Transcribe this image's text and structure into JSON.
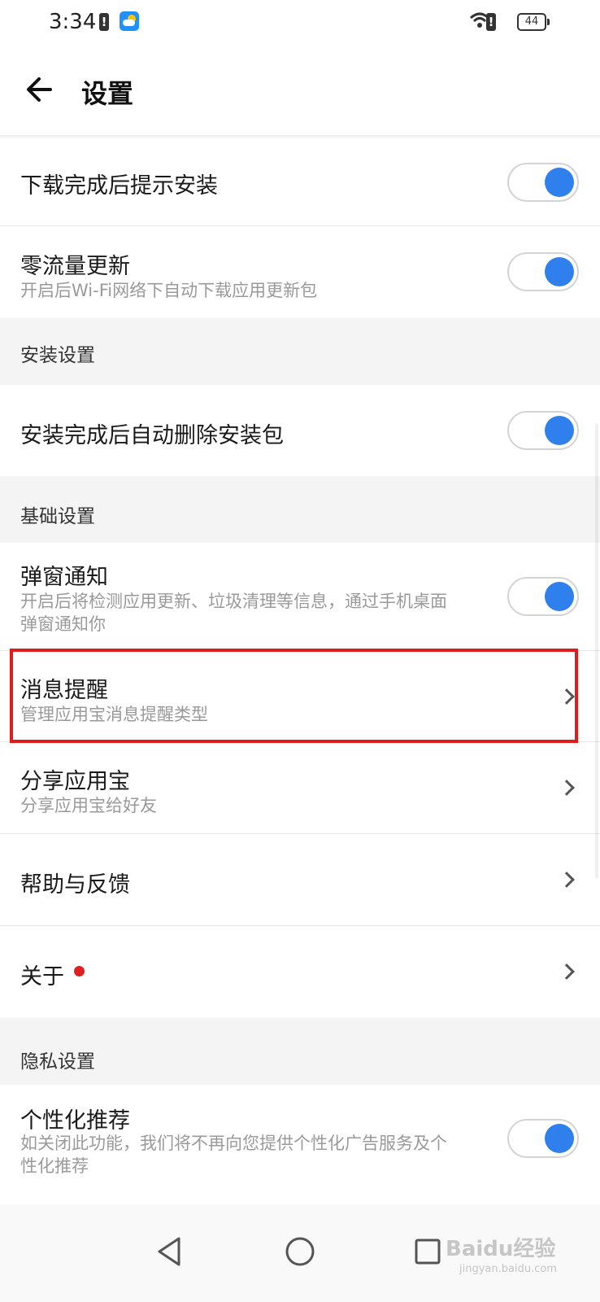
{
  "status_bar": {
    "time": "3:34",
    "battery_level": "44"
  },
  "header": {
    "title": "设置"
  },
  "items": {
    "download_prompt": {
      "title": "下载完成后提示安装",
      "enabled": true
    },
    "zero_traffic": {
      "title": "零流量更新",
      "desc": "开启后Wi-Fi网络下自动下载应用更新包",
      "enabled": true
    },
    "auto_delete": {
      "title": "安装完成后自动删除安装包",
      "enabled": true
    },
    "popup_notice": {
      "title": "弹窗通知",
      "desc": "开启后将检测应用更新、垃圾清理等信息，通过手机桌面弹窗通知你",
      "enabled": true
    },
    "message_reminder": {
      "title": "消息提醒",
      "desc": "管理应用宝消息提醒类型"
    },
    "share_app": {
      "title": "分享应用宝",
      "desc": "分享应用宝给好友"
    },
    "help_feedback": {
      "title": "帮助与反馈"
    },
    "about": {
      "title": "关于"
    },
    "personalized": {
      "title": "个性化推荐",
      "desc": "如关闭此功能，我们将不再向您提供个性化广告服务及个性化推荐",
      "enabled": true
    }
  },
  "sections": {
    "install": "安装设置",
    "basic": "基础设置",
    "privacy": "隐私设置"
  },
  "colors": {
    "accent": "#2f80ed",
    "highlight": "#e01c1c",
    "section_bg": "#f4f4f4"
  },
  "watermark": {
    "text": "Baidu经验",
    "sub": "jingyan.baidu.com"
  }
}
